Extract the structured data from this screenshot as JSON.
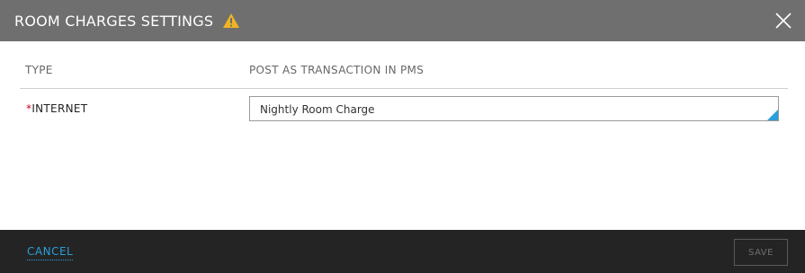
{
  "header": {
    "title": "ROOM CHARGES SETTINGS",
    "warning_icon": "warning-triangle-icon",
    "close_icon": "close-icon"
  },
  "table": {
    "columns": [
      "TYPE",
      "POST AS TRANSACTION IN PMS"
    ],
    "rows": [
      {
        "required_marker": "*",
        "type": "INTERNET",
        "post_as": "Nightly Room Charge"
      }
    ]
  },
  "footer": {
    "cancel_label": "CANCEL",
    "save_label": "SAVE"
  },
  "colors": {
    "header_bg": "#6f6f6f",
    "footer_bg": "#242424",
    "accent": "#2a9fd8",
    "warning": "#f0b323",
    "required": "#d0021b"
  }
}
